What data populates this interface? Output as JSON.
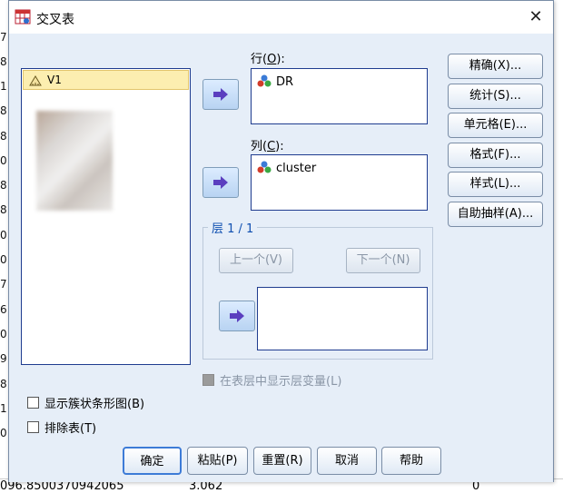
{
  "background": {
    "row_fragments": [
      "7",
      "8",
      "1",
      "8",
      "8",
      "0",
      "8",
      "8",
      "0",
      "0",
      "7",
      "6",
      "0",
      "9",
      "8",
      "1",
      "0"
    ],
    "bottom_row": {
      "left_value": "096.8500370942065",
      "middle_value": "3.062",
      "right_value": "0"
    }
  },
  "dialog": {
    "title": "交叉表",
    "close_label": "X"
  },
  "variable_list": {
    "items": [
      {
        "label": "V1",
        "selected": true
      }
    ]
  },
  "rows": {
    "label_prefix": "行(",
    "mnemonic": "O",
    "label_suffix": "):",
    "items": [
      {
        "label": "DR"
      }
    ]
  },
  "columns": {
    "label_prefix": "列(",
    "mnemonic": "C",
    "label_suffix": "):",
    "items": [
      {
        "label": "cluster"
      }
    ]
  },
  "layer": {
    "legend": "层 1 / 1",
    "prev_label": "上一个(V)",
    "next_label": "下一个(N)"
  },
  "options": {
    "show_layer_variables": "在表层中显示层变量(L)",
    "show_clustered_bar": "显示簇状条形图(B)",
    "suppress_tables": "排除表(T)"
  },
  "side_buttons": {
    "exact": "精确(X)...",
    "statistics": "统计(S)...",
    "cells": "单元格(E)...",
    "format": "格式(F)...",
    "style": "样式(L)...",
    "bootstrap": "自助抽样(A)..."
  },
  "bottom_buttons": {
    "ok": "确定",
    "paste": "粘贴(P)",
    "reset": "重置(R)",
    "cancel": "取消",
    "help": "帮助"
  },
  "colors": {
    "dialog_background": "#e6eef8",
    "list_border": "#1f3c8f",
    "arrow_color": "#5b3fbf",
    "selected_item": "#fceeb0",
    "disabled_text": "#8a96a6"
  }
}
